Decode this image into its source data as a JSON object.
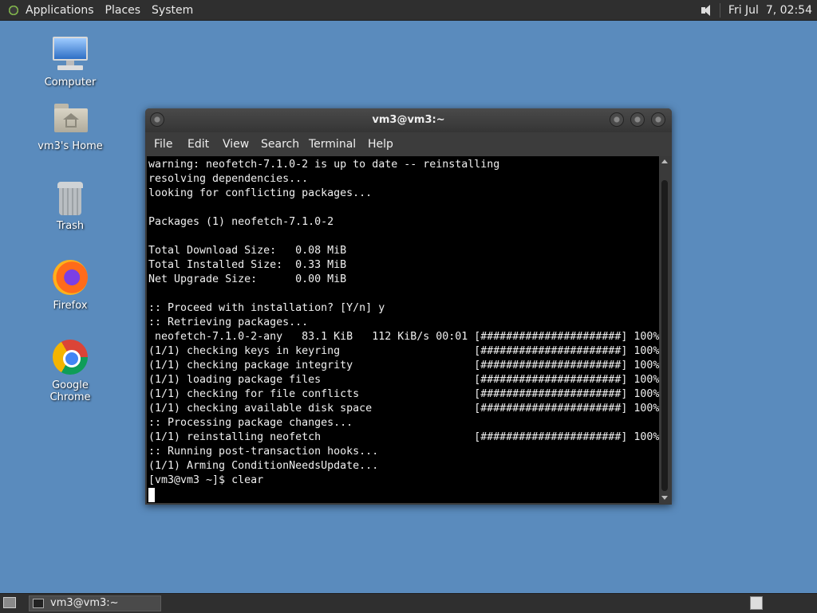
{
  "top_panel": {
    "menus": [
      "Applications",
      "Places",
      "System"
    ],
    "clock": "Fri Jul  7, 02:54"
  },
  "desktop_icons": [
    {
      "label": "Computer",
      "icon": "computer-icon"
    },
    {
      "label": "vm3's Home",
      "icon": "home-folder-icon"
    },
    {
      "label": "Trash",
      "icon": "trash-icon"
    },
    {
      "label": "Firefox",
      "icon": "firefox-icon"
    },
    {
      "label": "Google Chrome",
      "icon": "chrome-icon"
    }
  ],
  "terminal": {
    "title": "vm3@vm3:~",
    "menu": [
      "File",
      "Edit",
      "View",
      "Search",
      "Terminal",
      "Help"
    ],
    "lines": [
      "warning: neofetch-7.1.0-2 is up to date -- reinstalling",
      "resolving dependencies...",
      "looking for conflicting packages...",
      "",
      "Packages (1) neofetch-7.1.0-2",
      "",
      "Total Download Size:   0.08 MiB",
      "Total Installed Size:  0.33 MiB",
      "Net Upgrade Size:      0.00 MiB",
      "",
      ":: Proceed with installation? [Y/n] y",
      ":: Retrieving packages...",
      " neofetch-7.1.0-2-any   83.1 KiB   112 KiB/s 00:01 [######################] 100%",
      "(1/1) checking keys in keyring                     [######################] 100%",
      "(1/1) checking package integrity                   [######################] 100%",
      "(1/1) loading package files                        [######################] 100%",
      "(1/1) checking for file conflicts                  [######################] 100%",
      "(1/1) checking available disk space                [######################] 100%",
      ":: Processing package changes...",
      "(1/1) reinstalling neofetch                        [######################] 100%",
      ":: Running post-transaction hooks...",
      "(1/1) Arming ConditionNeedsUpdate...",
      "[vm3@vm3 ~]$ clear"
    ]
  },
  "taskbar": {
    "window_label": "vm3@vm3:~"
  }
}
